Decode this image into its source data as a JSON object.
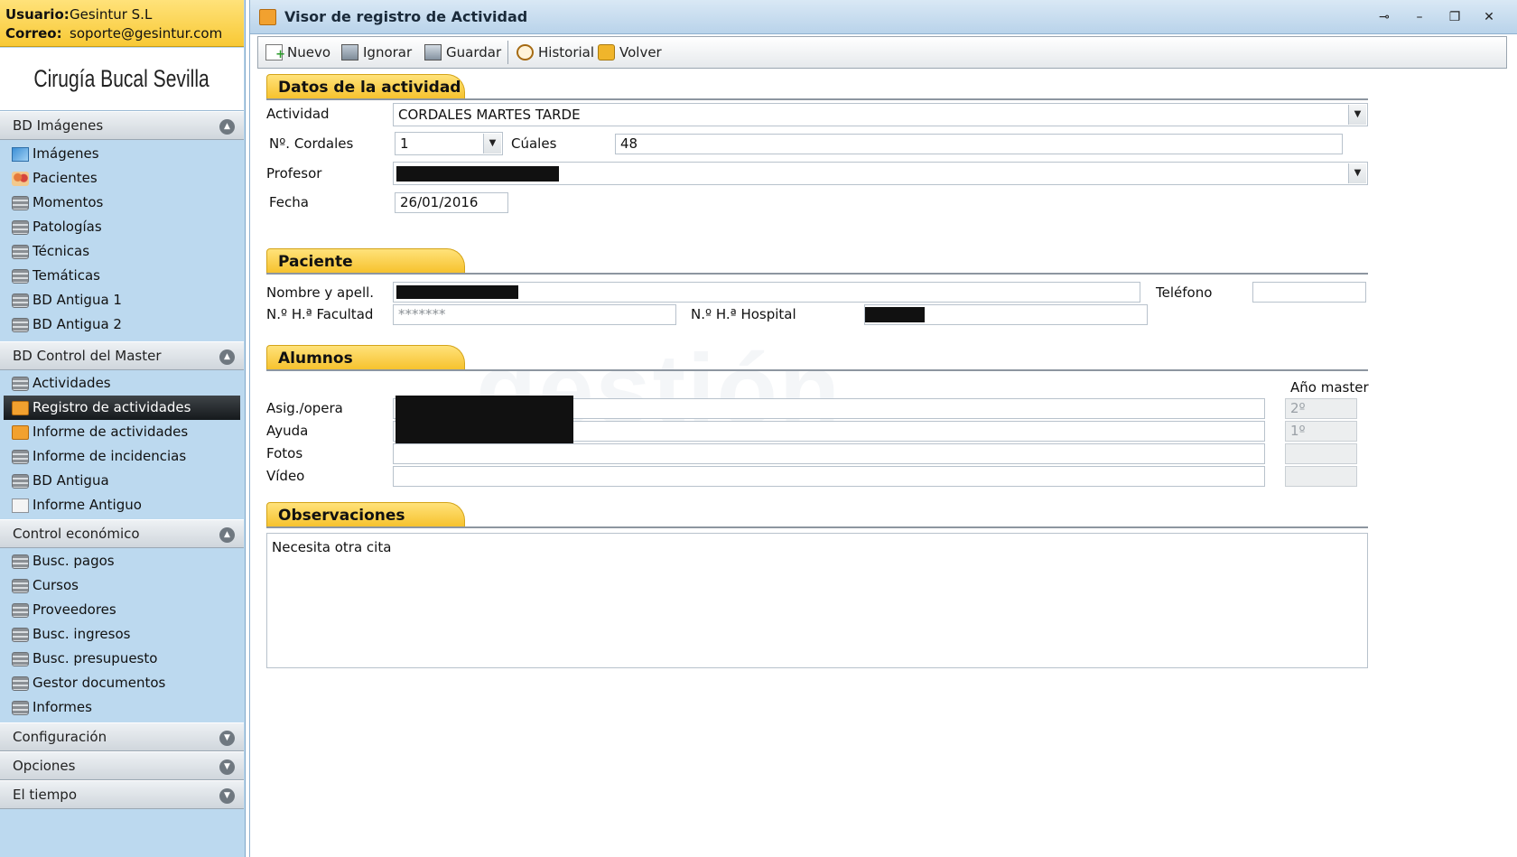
{
  "user": {
    "user_label": "Usuario:",
    "user_value": "Gesintur S.L",
    "mail_label": "Correo:",
    "mail_value": "soporte@gesintur.com"
  },
  "clinic_title": "Cirugía Bucal Sevilla",
  "sidebar": {
    "groups": [
      {
        "label": "BD Imágenes",
        "items": [
          {
            "label": "Imágenes",
            "icon": "image-icon"
          },
          {
            "label": "Pacientes",
            "icon": "people-icon"
          },
          {
            "label": "Momentos",
            "icon": "database-icon"
          },
          {
            "label": "Patologías",
            "icon": "database-icon"
          },
          {
            "label": "Técnicas",
            "icon": "database-icon"
          },
          {
            "label": "Temáticas",
            "icon": "database-icon"
          },
          {
            "label": "BD Antigua 1",
            "icon": "database-icon"
          },
          {
            "label": "BD Antigua 2",
            "icon": "database-icon"
          }
        ]
      },
      {
        "label": "BD Control del Master",
        "items": [
          {
            "label": "Actividades",
            "icon": "database-icon"
          },
          {
            "label": "Registro de actividades",
            "icon": "report-icon",
            "selected": true
          },
          {
            "label": "Informe de actividades",
            "icon": "report-icon"
          },
          {
            "label": "Informe de incidencias",
            "icon": "database-icon"
          },
          {
            "label": "BD Antigua",
            "icon": "database-icon"
          },
          {
            "label": "Informe Antiguo",
            "icon": "document-icon"
          }
        ]
      },
      {
        "label": "Control económico",
        "items": [
          {
            "label": "Busc. pagos",
            "icon": "database-icon"
          },
          {
            "label": "Cursos",
            "icon": "database-icon"
          },
          {
            "label": "Proveedores",
            "icon": "database-icon"
          },
          {
            "label": "Busc. ingresos",
            "icon": "database-icon"
          },
          {
            "label": "Busc. presupuesto",
            "icon": "database-icon"
          },
          {
            "label": "Gestor documentos",
            "icon": "database-icon"
          },
          {
            "label": "Informes",
            "icon": "database-icon"
          }
        ]
      },
      {
        "label": "Configuración",
        "items": []
      },
      {
        "label": "Opciones",
        "items": []
      },
      {
        "label": "El tiempo",
        "items": []
      }
    ]
  },
  "window": {
    "title": "Visor de registro de Actividad",
    "controls": {
      "pin": "⊸",
      "minimize": "–",
      "restore": "❐",
      "close": "✕"
    }
  },
  "toolbar": {
    "new": "Nuevo",
    "ignore": "Ignorar",
    "save": "Guardar",
    "history": "Historial",
    "back": "Volver"
  },
  "form": {
    "activity_section": "Datos de la actividad",
    "activity_label": "Actividad",
    "activity_value": "CORDALES MARTES TARDE",
    "cordales_label": "Nº. Cordales",
    "cordales_value": "1",
    "cuales_label": "Cúales",
    "cuales_value": "48",
    "profesor_label": "Profesor",
    "profesor_value": "",
    "fecha_label": "Fecha",
    "fecha_value": "26/01/2016",
    "patient_section": "Paciente",
    "nombre_label": "Nombre y apell.",
    "nombre_value": "",
    "telefono_label": "Teléfono",
    "telefono_value": "",
    "facultad_label": "N.º H.ª Facultad",
    "facultad_value": "*******",
    "hospital_label": "N.º H.ª Hospital",
    "hospital_value": "",
    "alumnos_section": "Alumnos",
    "anio_master_label": "Año master",
    "asig_label": "Asig./opera",
    "asig_year": "2º",
    "ayuda_label": "Ayuda",
    "ayuda_year": "1º",
    "fotos_label": "Fotos",
    "video_label": "Vídeo",
    "obs_section": "Observaciones",
    "obs_value": "Necesita otra cita"
  }
}
